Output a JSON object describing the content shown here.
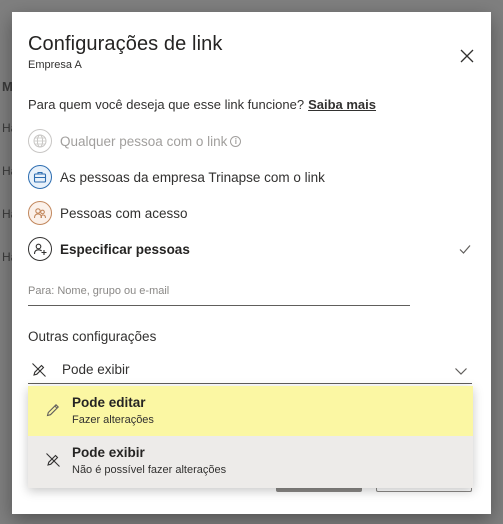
{
  "background": {
    "letters": [
      "M",
      "Ha",
      "Ha",
      "Ha",
      "Ha"
    ]
  },
  "dialog": {
    "title": "Configurações de link",
    "subtitle": "Empresa A",
    "close_icon": "close-icon",
    "question": "Para quem você deseja que esse link funcione?",
    "learn_more": "Saiba mais",
    "options": [
      {
        "label": "Qualquer pessoa com o link",
        "icon": "globe-icon",
        "disabled": true
      },
      {
        "label": "As pessoas da empresa Trinapse com o link",
        "icon": "briefcase-icon"
      },
      {
        "label": "Pessoas com acesso",
        "icon": "people-icon"
      },
      {
        "label": "Especificar pessoas",
        "icon": "person-add-icon",
        "selected": true
      }
    ],
    "people_input": {
      "placeholder": "Para: Nome, grupo ou e-mail",
      "value": ""
    },
    "other_settings_heading": "Outras configurações",
    "permission": {
      "selected_label": "Pode exibir",
      "options": [
        {
          "title": "Pode editar",
          "subtitle": "Fazer alterações",
          "icon": "pencil-icon",
          "highlighted": true
        },
        {
          "title": "Pode exibir",
          "subtitle": "Não é possível fazer alterações",
          "icon": "no-edit-icon",
          "selected": true
        }
      ]
    },
    "colors": {
      "highlight": "#fbf7a3",
      "selected_bg": "#edebe9",
      "company_icon": "#2b6cb0",
      "people_icon": "#c2875c"
    }
  }
}
